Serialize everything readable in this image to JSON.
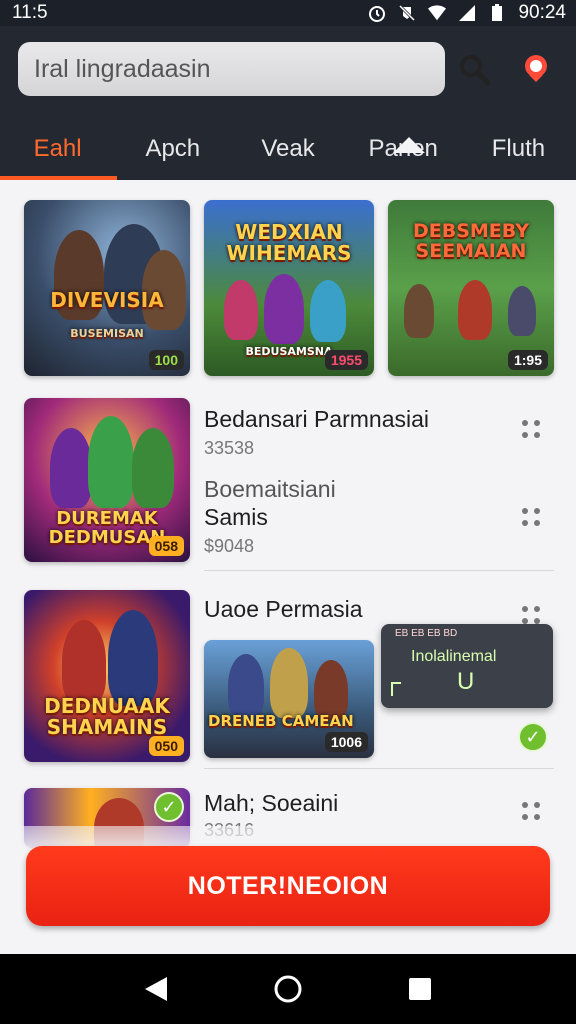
{
  "status": {
    "time": "11:5",
    "clock_right": "90:24"
  },
  "search": {
    "text": "Iral lingradaasin"
  },
  "tabs": [
    "Eahl",
    "Apch",
    "Veak",
    "Panen",
    "Fluth"
  ],
  "featured": [
    {
      "title": "DIVEVISIA",
      "subtitle": "BUSEMISAN",
      "badge": "100",
      "badge_color": "#9be04a"
    },
    {
      "title": "WEDXIAN WIHEMARS",
      "subtitle": "BEDUSAMSNA",
      "badge": "1955",
      "badge_color": "#ff4d6d"
    },
    {
      "title": "DEBSMEBY SEEMAIAN",
      "subtitle": "",
      "badge": "1:95",
      "badge_color": "#ffffff"
    }
  ],
  "items": [
    {
      "thumb_title": "DUREMAK DEDMUSAN",
      "badge": "058",
      "title": "Bedansari Parmnasiai",
      "sub": "33538",
      "title2": "Boemaitsiani",
      "title3": "Samis",
      "price": "$9048"
    },
    {
      "thumb_title": "DEDNUAAK SHAMAINS",
      "badge": "050",
      "title": "Uaoe Permasia",
      "inner_title": "DRENEB CAMEAN",
      "inner_badge": "1006",
      "popup": {
        "top": "Inolalinemal",
        "mark": "U",
        "codes": "EB EB EB BD"
      }
    },
    {
      "title": "Mah; Soeaini",
      "sub": "33616"
    }
  ],
  "cta": {
    "label": "NOTER!NEOION"
  }
}
